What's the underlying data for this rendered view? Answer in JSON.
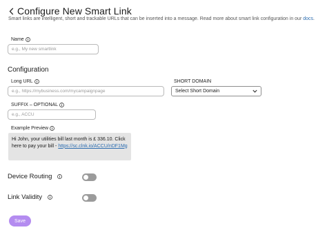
{
  "header": {
    "title": "Configure New Smart Link",
    "description": "Smart links are intelligent, short and trackable URLs that can be inserted into a message. Read more about smart link configuration in our ",
    "docs_link": "docs",
    "description_end": "."
  },
  "name_field": {
    "label": "Name",
    "placeholder": "e.g., My new smartlink",
    "value": ""
  },
  "configuration": {
    "section_title": "Configuration",
    "long_url": {
      "label": "Long URL",
      "placeholder": "e.g., https://mybusiness.com/mycampaignpage",
      "value": ""
    },
    "short_domain": {
      "label": "SHORT DOMAIN",
      "selected": "Select Short Domain"
    },
    "suffix": {
      "label": "SUFFIX – OPTIONAL",
      "placeholder": "e.g., ACCU",
      "value": ""
    },
    "example_preview": {
      "label": "Example Preview",
      "text": "Hi John, your utilities bill last month is £ 336.10. Click here to pay your bill - ",
      "link": "https://sc.clnk.io/ACCU/nDF1Mg"
    }
  },
  "device_routing": {
    "label": "Device Routing",
    "enabled": false
  },
  "link_validity": {
    "label": "Link Validity",
    "enabled": false
  },
  "actions": {
    "save_label": "Save"
  },
  "colors": {
    "accent": "#b48cf0",
    "link": "#2b6cb0",
    "toggle_off": "#9b9b9b",
    "preview_bg": "#e4e4e4"
  },
  "icons": [
    "chevron-left-icon",
    "info-icon",
    "chevron-down-icon"
  ]
}
